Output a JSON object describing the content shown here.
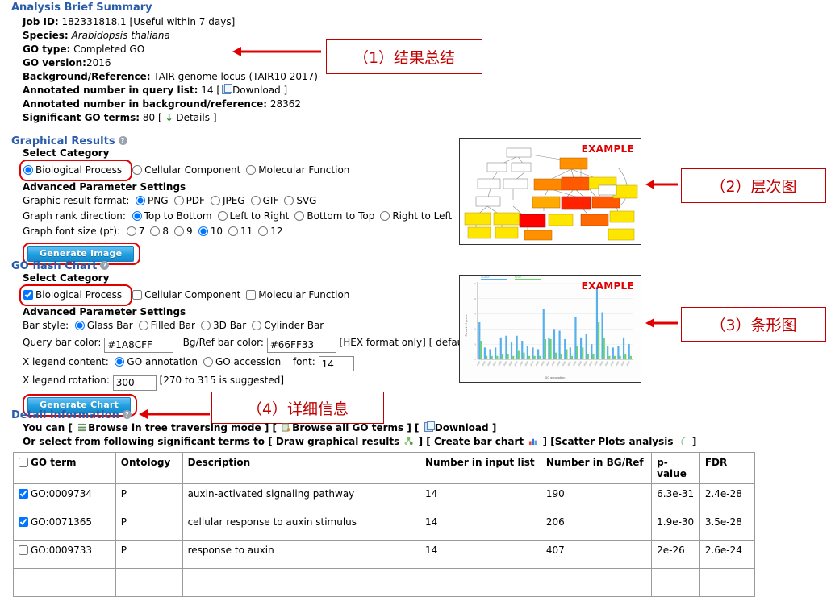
{
  "summary": {
    "heading": "Analysis Brief Summary",
    "help_icon": "help-icon",
    "fields": [
      {
        "label": "Job ID:",
        "value": "182331818.1 [Useful within 7 days]"
      },
      {
        "label": "Species:",
        "value": "Arabidopsis thaliana",
        "italic": true
      },
      {
        "label": "GO type:",
        "value": "Completed GO"
      },
      {
        "label": "GO version:",
        "value": "2016",
        "nospace": true
      },
      {
        "label": "Background/Reference:",
        "value": "TAIR genome locus (TAIR10 2017)"
      },
      {
        "label": "Annotated number in query list:",
        "value": "14",
        "suffix": "[ Download ]",
        "link": "Download"
      },
      {
        "label": "Annotated number in background/reference:",
        "value": "28362"
      },
      {
        "label": "Significant GO terms:",
        "value": "80",
        "suffix": "[ Details ]",
        "link": "Details"
      }
    ]
  },
  "graphical_results": {
    "heading": "Graphical Results",
    "select_category_label": "Select Category",
    "categories": [
      {
        "label": "Biological Process",
        "checked": true,
        "highlighted": true
      },
      {
        "label": "Cellular Component",
        "checked": false,
        "highlighted": false
      },
      {
        "label": "Molecular Function",
        "checked": false,
        "highlighted": false
      }
    ],
    "advanced_label": "Advanced Parameter Settings",
    "format_label": "Graphic result format:",
    "formats": [
      {
        "label": "PNG",
        "checked": true
      },
      {
        "label": "PDF",
        "checked": false
      },
      {
        "label": "JPEG",
        "checked": false
      },
      {
        "label": "GIF",
        "checked": false
      },
      {
        "label": "SVG",
        "checked": false
      }
    ],
    "rank_label": "Graph rank direction:",
    "ranks": [
      {
        "label": "Top to Bottom",
        "checked": true
      },
      {
        "label": "Left to Right",
        "checked": false
      },
      {
        "label": "Bottom to Top",
        "checked": false
      },
      {
        "label": "Right to Left",
        "checked": false
      }
    ],
    "fontsize_label": "Graph font size (pt):",
    "fontsizes": [
      {
        "label": "7",
        "checked": false
      },
      {
        "label": "8",
        "checked": false
      },
      {
        "label": "9",
        "checked": false
      },
      {
        "label": "10",
        "checked": true
      },
      {
        "label": "11",
        "checked": false
      },
      {
        "label": "12",
        "checked": false
      }
    ],
    "button_label": "Generate Image"
  },
  "flash_chart": {
    "heading": "GO flash Chart",
    "select_category_label": "Select Category",
    "categories": [
      {
        "label": "Biological Process",
        "checked": true,
        "highlighted": true
      },
      {
        "label": "Cellular Component",
        "checked": false,
        "highlighted": false
      },
      {
        "label": "Molecular Function",
        "checked": false,
        "highlighted": false
      }
    ],
    "advanced_label": "Advanced Parameter Settings",
    "barstyle_label": "Bar style:",
    "barstyles": [
      {
        "label": "Glass Bar",
        "checked": true
      },
      {
        "label": "Filled Bar",
        "checked": false
      },
      {
        "label": "3D Bar",
        "checked": false
      },
      {
        "label": "Cylinder Bar",
        "checked": false
      }
    ],
    "query_color_label": "Query bar color:",
    "query_color_value": "#1A8CFF",
    "bgref_color_label": "Bg/Ref bar color:",
    "bgref_color_value": "#66FF33",
    "hex_note": "[HEX format only] [ default ]",
    "legend_content_label": "X legend content:",
    "legend_contents": [
      {
        "label": "GO annotation",
        "checked": true
      },
      {
        "label": "GO accession",
        "checked": false
      }
    ],
    "font_label": "font:",
    "font_value": "14",
    "rotation_label": "X legend rotation:",
    "rotation_value": "300",
    "rotation_note": "[270 to 315 is suggested]",
    "button_label": "Generate Chart"
  },
  "examples": {
    "tag": "EXAMPLE",
    "hierarchy_alt": "GO hierarchy graph example",
    "barchart_alt": "GO bar chart example"
  },
  "chart_data": {
    "type": "bar",
    "title": "",
    "xlabel": "GO annotation",
    "ylabel": "Percent of genes",
    "legend": [
      "Input list",
      "Bg/Ref"
    ],
    "legend_position": "top-left",
    "grid": true,
    "ylim": [
      0,
      45
    ],
    "categories": [
      "c1",
      "c2",
      "c3",
      "c4",
      "c5",
      "c6",
      "c7",
      "c8",
      "c9",
      "c10",
      "c11",
      "c12",
      "c13",
      "c14",
      "c15",
      "c16",
      "c17",
      "c18",
      "c19",
      "c20",
      "c21",
      "c22",
      "c23",
      "c24",
      "c25",
      "c26",
      "c27",
      "c28",
      "c29"
    ],
    "series": [
      {
        "name": "Input list",
        "color": "#55b0ec",
        "values": [
          22,
          7,
          6,
          7,
          13,
          14,
          10,
          14,
          11,
          8,
          7,
          6,
          30,
          13,
          18,
          17,
          12,
          7,
          25,
          13,
          15,
          9,
          43,
          28,
          8,
          7,
          8,
          13,
          9
        ]
      },
      {
        "name": "Bg/Ref",
        "color": "#6ad46a",
        "values": [
          11,
          2,
          2,
          2,
          3,
          3,
          2,
          5,
          4,
          2,
          2,
          2,
          12,
          12,
          4,
          3,
          6,
          2,
          8,
          7,
          3,
          3,
          22,
          13,
          2,
          2,
          2,
          3,
          2
        ]
      }
    ]
  },
  "callouts": [
    {
      "id": "1",
      "text": "（1）结果总结"
    },
    {
      "id": "2",
      "text": "（2）层次图"
    },
    {
      "id": "3",
      "text": "（3）条形图"
    },
    {
      "id": "4",
      "text": "（4）详细信息"
    }
  ],
  "detail": {
    "heading": "Detail information",
    "line1_prefix": "You can [",
    "browse_tree": "Browse in tree traversing mode",
    "browse_all": "Browse all GO terms",
    "download": "Download",
    "line2_prefix": "Or select from following significant terms to [",
    "draw_graphical": "Draw graphical results",
    "create_bar": "Create bar chart",
    "scatter": "Scatter Plots analysis",
    "bracket_open": "[",
    "bracket_close": "]"
  },
  "table": {
    "columns": [
      {
        "key": "go_term",
        "label": "GO term",
        "has_checkbox": true
      },
      {
        "key": "ontology",
        "label": "Ontology"
      },
      {
        "key": "description",
        "label": "Description"
      },
      {
        "key": "number_input",
        "label": "Number in input list"
      },
      {
        "key": "number_bg",
        "label": "Number in BG/Ref"
      },
      {
        "key": "pvalue",
        "label": "p-value"
      },
      {
        "key": "fdr",
        "label": "FDR"
      }
    ],
    "rows": [
      {
        "checked": true,
        "go_term": "GO:0009734",
        "ontology": "P",
        "description": "auxin-activated signaling pathway",
        "number_input": "14",
        "number_bg": "190",
        "pvalue": "6.3e-31",
        "fdr": "2.4e-28"
      },
      {
        "checked": true,
        "go_term": "GO:0071365",
        "ontology": "P",
        "description": "cellular response to auxin stimulus",
        "number_input": "14",
        "number_bg": "206",
        "pvalue": "1.9e-30",
        "fdr": "3.5e-28"
      },
      {
        "checked": false,
        "go_term": "GO:0009733",
        "ontology": "P",
        "description": "response to auxin",
        "number_input": "14",
        "number_bg": "407",
        "pvalue": "2e-26",
        "fdr": "2.6e-24"
      }
    ]
  },
  "colors": {
    "heading_blue": "#2a5caa",
    "annotation_red": "#c00000",
    "arrow_red": "#e00000",
    "button_blue": "#1e9fe0",
    "query_bar": "#1A8CFF",
    "bgref_bar": "#66FF33"
  }
}
